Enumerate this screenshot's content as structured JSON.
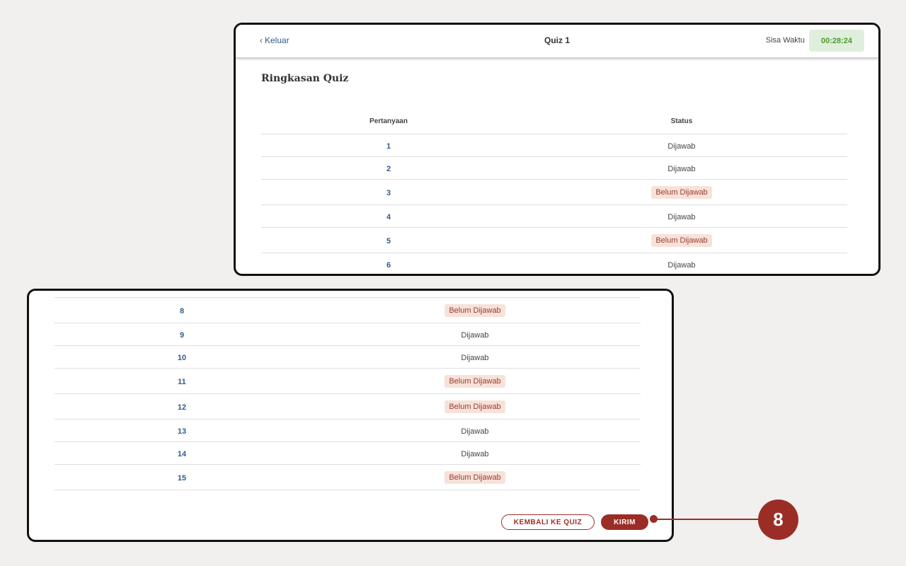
{
  "header": {
    "back_label": "Keluar",
    "title": "Quiz 1",
    "time_label": "Sisa Waktu",
    "time_remaining": "00:28:24"
  },
  "summary_title": "Ringkasan Quiz",
  "table": {
    "col_question": "Pertanyaan",
    "col_status": "Status"
  },
  "rows_top": [
    {
      "q": "1",
      "status": "Dijawab",
      "answered": true
    },
    {
      "q": "2",
      "status": "Dijawab",
      "answered": true
    },
    {
      "q": "3",
      "status": "Belum Dijawab",
      "answered": false
    },
    {
      "q": "4",
      "status": "Dijawab",
      "answered": true
    },
    {
      "q": "5",
      "status": "Belum Dijawab",
      "answered": false
    },
    {
      "q": "6",
      "status": "Dijawab",
      "answered": true
    }
  ],
  "rows_bottom": [
    {
      "q": "8",
      "status": "Belum Dijawab",
      "answered": false
    },
    {
      "q": "9",
      "status": "Dijawab",
      "answered": true
    },
    {
      "q": "10",
      "status": "Dijawab",
      "answered": true
    },
    {
      "q": "11",
      "status": "Belum Dijawab",
      "answered": false
    },
    {
      "q": "12",
      "status": "Belum Dijawab",
      "answered": false
    },
    {
      "q": "13",
      "status": "Dijawab",
      "answered": true
    },
    {
      "q": "14",
      "status": "Dijawab",
      "answered": true
    },
    {
      "q": "15",
      "status": "Belum Dijawab",
      "answered": false
    }
  ],
  "actions": {
    "back_to_quiz": "KEMBALI KE QUIZ",
    "submit": "KIRIM"
  },
  "callout_number": "8",
  "colors": {
    "accent": "#9b2d27",
    "link": "#2f5d8a",
    "timer_bg": "#dfeedd",
    "timer_text": "#4f9a2b",
    "unanswered_bg": "#f7e2d9"
  },
  "icons": {
    "back": "chevron-left-icon"
  }
}
